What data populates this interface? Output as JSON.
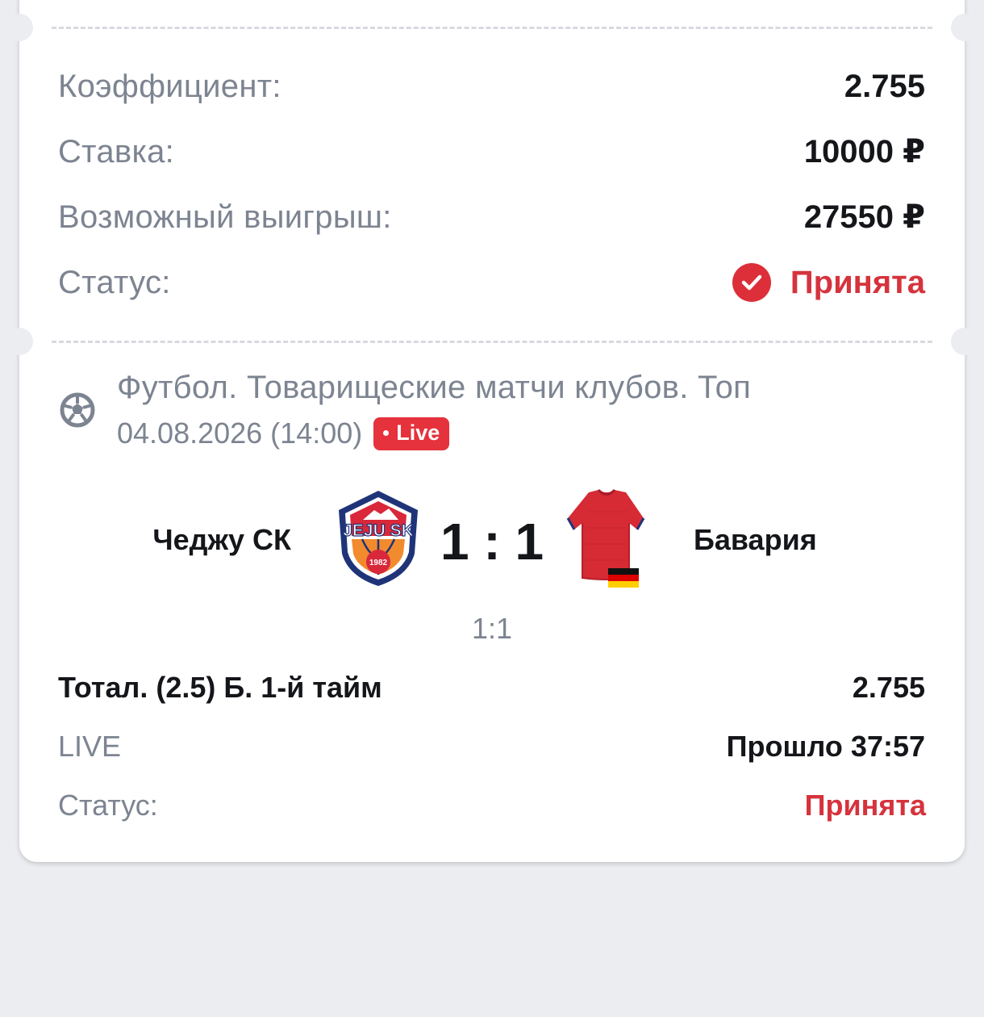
{
  "summary": {
    "coefficient_label": "Коэффициент:",
    "coefficient_value": "2.755",
    "stake_label": "Ставка:",
    "stake_value": "10000 ₽",
    "win_label": "Возможный выигрыш:",
    "win_value": "27550 ₽",
    "status_label": "Статус:",
    "status_value": "Принята"
  },
  "event": {
    "icon": "soccer-ball-icon",
    "league": "Футбол. Товарищеские матчи клубов. Топ",
    "date": "04.08.2026 (14:00)",
    "live_badge": "Live",
    "home_team": "Чеджу СК",
    "home_logo_text": "JEJU SK",
    "home_logo_year": "1982",
    "away_team": "Бавария",
    "away_logo": "red-jersey-germany-flag",
    "score": "1 : 1",
    "half_score": "1:1"
  },
  "bet": {
    "market": "Тотал. (2.5) Б. 1-й тайм",
    "odds": "2.755",
    "type_label": "LIVE",
    "elapsed": "Прошло 37:57",
    "status_label": "Статус:",
    "status_value": "Принята"
  },
  "colors": {
    "accent_red": "#d5333d",
    "background": "#ebedf0",
    "muted_text": "#7d8491",
    "dark_text": "#14161a"
  }
}
